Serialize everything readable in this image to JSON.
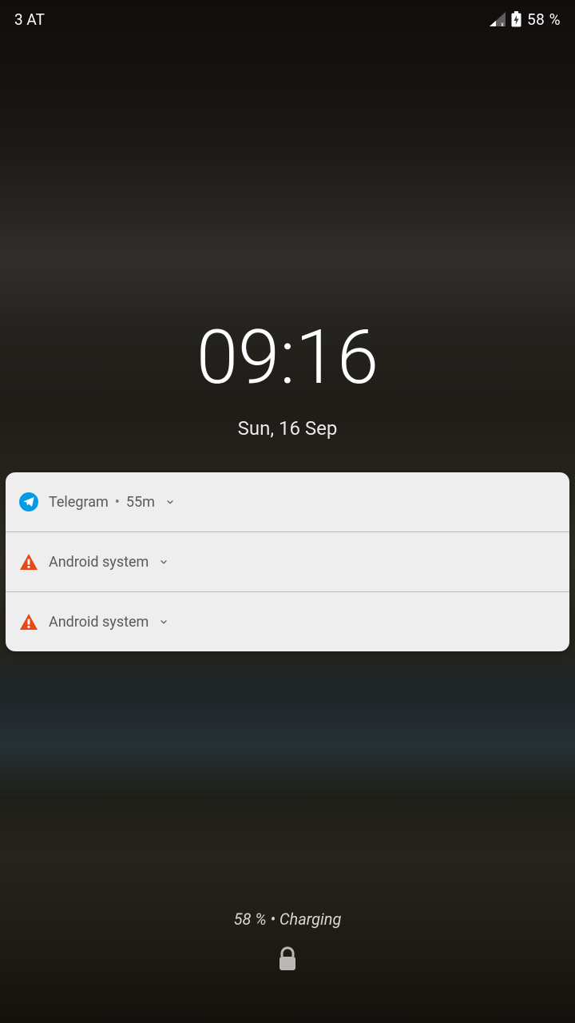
{
  "status": {
    "carrier": "3 AT",
    "battery_percent": "58 %"
  },
  "clock": {
    "time": "09:16",
    "date": "Sun, 16 Sep"
  },
  "notifications": [
    {
      "app": "Telegram",
      "age": "55m",
      "icon": "telegram"
    },
    {
      "app": "Android system",
      "age": "",
      "icon": "warning"
    },
    {
      "app": "Android system",
      "age": "",
      "icon": "warning"
    }
  ],
  "bottom": {
    "status": "58 % • Charging"
  }
}
